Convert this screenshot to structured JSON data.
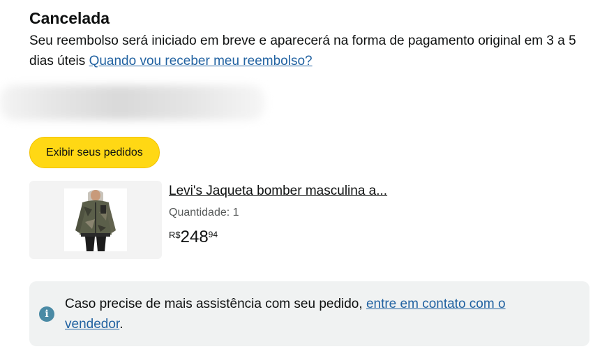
{
  "status": {
    "title": "Cancelada",
    "message": "Seu reembolso será iniciado em breve e aparecerá na forma de pagamento original em 3 a 5 dias úteis",
    "refund_link": "Quando vou receber meu reembolso?"
  },
  "actions": {
    "view_orders_label": "Exibir seus pedidos"
  },
  "product": {
    "title": "Levi's Jaqueta bomber masculina a...",
    "quantity_label": "Quantidade: 1",
    "price": {
      "currency": "R$",
      "whole": "248",
      "fraction": "94"
    }
  },
  "help": {
    "text": "Caso precise de mais assistência com seu pedido, ",
    "contact_link": "entre em contato com o vendedor",
    "suffix": ".",
    "icon": "info-icon",
    "icon_color": "#4a8aa5"
  },
  "colors": {
    "button": "#ffd814",
    "link": "#2162a1",
    "help_bg": "#f0f2f2"
  }
}
